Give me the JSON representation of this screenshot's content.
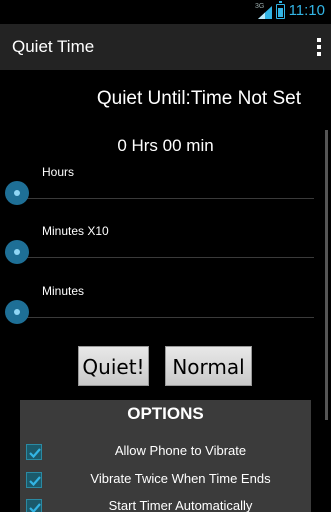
{
  "status_bar": {
    "network": "3G",
    "time": "11:10",
    "icons": [
      "signal-icon",
      "battery-icon"
    ]
  },
  "action_bar": {
    "title": "Quiet Time",
    "overflow_icon": "overflow-menu-icon"
  },
  "quiet_until": "Quiet Until:Time Not Set",
  "duration": "0 Hrs 00 min",
  "sliders": [
    {
      "label": "Hours",
      "value": 0
    },
    {
      "label": "Minutes X10",
      "value": 0
    },
    {
      "label": "Minutes",
      "value": 0
    }
  ],
  "buttons": {
    "quiet": "Quiet!",
    "normal": "Normal"
  },
  "options": {
    "title": "OPTIONS",
    "items": [
      {
        "label": "Allow Phone to Vibrate",
        "checked": true
      },
      {
        "label": "Vibrate Twice When Time Ends",
        "checked": true
      },
      {
        "label": "Start Timer Automatically",
        "checked": true
      }
    ]
  },
  "colors": {
    "accent": "#33b5e5",
    "slider_thumb": "#1e6f96",
    "action_bar": "#232323",
    "options_panel": "#3b3b3b"
  }
}
